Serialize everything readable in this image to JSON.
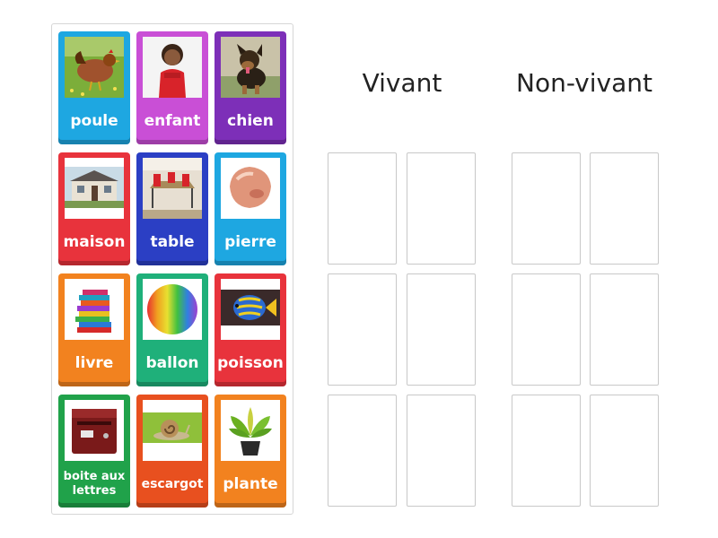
{
  "cards": [
    {
      "label": "poule",
      "color": "#1ea7e1",
      "icon": "hen-photo"
    },
    {
      "label": "enfant",
      "color": "#c94fd6",
      "icon": "child-photo"
    },
    {
      "label": "chien",
      "color": "#7d2fb8",
      "icon": "dog-photo"
    },
    {
      "label": "maison",
      "color": "#e8333c",
      "icon": "house-photo"
    },
    {
      "label": "table",
      "color": "#2b3fc4",
      "icon": "table-photo"
    },
    {
      "label": "pierre",
      "color": "#1ea7e1",
      "icon": "stone-photo"
    },
    {
      "label": "livre",
      "color": "#f2821f",
      "icon": "books-photo"
    },
    {
      "label": "ballon",
      "color": "#1fb07a",
      "icon": "ball-photo"
    },
    {
      "label": "poisson",
      "color": "#e8333c",
      "icon": "fish-photo"
    },
    {
      "label": "boite aux lettres",
      "color": "#20a24a",
      "icon": "mailbox-photo"
    },
    {
      "label": "escargot",
      "color": "#e8501f",
      "icon": "snail-photo"
    },
    {
      "label": "plante",
      "color": "#f2821f",
      "icon": "plant-photo"
    }
  ],
  "columns": [
    {
      "title": "Vivant"
    },
    {
      "title": "Non-vivant"
    }
  ]
}
